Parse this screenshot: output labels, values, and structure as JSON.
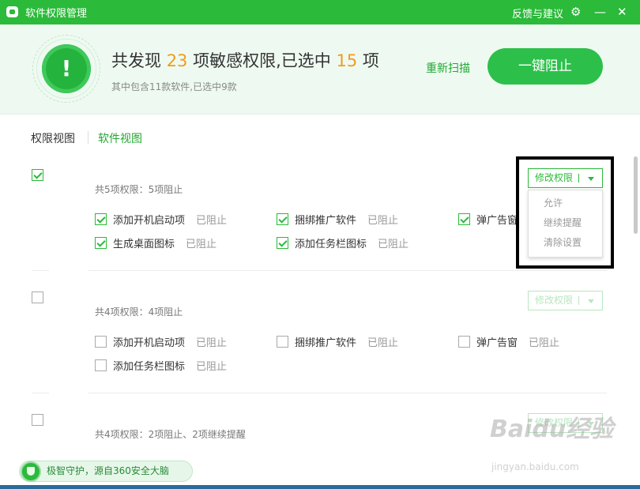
{
  "window": {
    "title": "软件权限管理",
    "feedback_label": "反馈与建议",
    "settings_icon": "gear-icon",
    "minimize_glyph": "—",
    "close_glyph": "✕"
  },
  "header": {
    "alert_icon_glyph": "!",
    "headline_prefix": "共发现",
    "found_count": "23",
    "headline_mid": "项敏感权限,已选中",
    "selected_count": "15",
    "headline_suffix": "项",
    "subline": "其中包含11款软件,已选中9款",
    "rescan_label": "重新扫描",
    "block_all_label": "一键阻止"
  },
  "tabs": {
    "permission_view": "权限视图",
    "software_view": "软件视图"
  },
  "cards": [
    {
      "checked": true,
      "summary": "共5项权限：5项阻止",
      "modify_label": "修改权限",
      "permissions": [
        {
          "name": "添加开机启动项",
          "state": "已阻止",
          "checked": true
        },
        {
          "name": "捆绑推广软件",
          "state": "已阻止",
          "checked": true
        },
        {
          "name": "弹广告窗",
          "state": "",
          "checked": true
        },
        {
          "name": "生成桌面图标",
          "state": "已阻止",
          "checked": true
        },
        {
          "name": "添加任务栏图标",
          "state": "已阻止",
          "checked": true
        }
      ]
    },
    {
      "checked": false,
      "summary": "共4项权限：4项阻止",
      "modify_label": "修改权限",
      "permissions": [
        {
          "name": "添加开机启动项",
          "state": "已阻止",
          "checked": false
        },
        {
          "name": "捆绑推广软件",
          "state": "已阻止",
          "checked": false
        },
        {
          "name": "弹广告窗",
          "state": "已阻止",
          "checked": false
        },
        {
          "name": "添加任务栏图标",
          "state": "已阻止",
          "checked": false
        }
      ]
    },
    {
      "checked": false,
      "summary": "共4项权限：2项阻止、2项继续提醒",
      "modify_label": "修改权限"
    }
  ],
  "dropdown": {
    "options": [
      "允许",
      "继续提醒",
      "清除设置"
    ]
  },
  "footer": {
    "badge_text": "极智守护，源自360安全大脑"
  },
  "watermark": {
    "brand": "Baidu经验",
    "url": "jingyan.baidu.com"
  },
  "colors": {
    "accent": "#2bba3a",
    "highlight_number": "#f39a1e"
  }
}
